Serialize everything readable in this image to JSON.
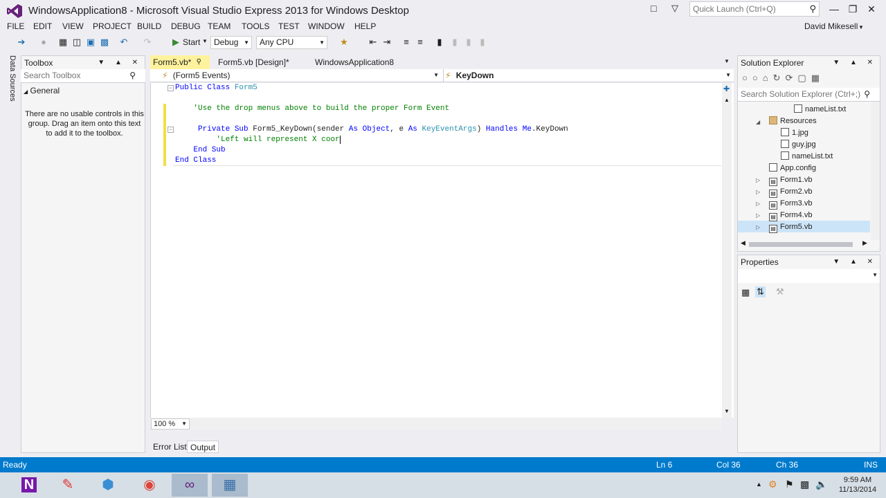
{
  "window": {
    "title": "WindowsApplication8 - Microsoft Visual Studio Express 2013 for Windows Desktop",
    "quick_launch_placeholder": "Quick Launch (Ctrl+Q)",
    "user": "David Mikesell"
  },
  "menu": [
    "FILE",
    "EDIT",
    "VIEW",
    "PROJECT",
    "BUILD",
    "DEBUG",
    "TEAM",
    "TOOLS",
    "TEST",
    "WINDOW",
    "HELP"
  ],
  "toolbar": {
    "start_label": "Start",
    "config": "Debug",
    "platform": "Any CPU"
  },
  "rail": {
    "label": "Data Sources"
  },
  "toolbox": {
    "title": "Toolbox",
    "search_placeholder": "Search Toolbox",
    "group": "General",
    "empty_message": "There are no usable controls in this group. Drag an item onto this text to add it to the toolbox."
  },
  "editor": {
    "tabs": [
      {
        "label": "Form5.vb*"
      },
      {
        "label": "Form5.vb [Design]*"
      },
      {
        "label": "WindowsApplication8"
      }
    ],
    "nav_left": "(Form5 Events)",
    "nav_right": "KeyDown",
    "code": {
      "line1_kw": "Public Class ",
      "line1_name": "Form5",
      "line2_comment": "'Use the drop menus above to build the proper Form Event",
      "line3_kw1": "Private Sub ",
      "line3_name": "Form5_KeyDown(sender ",
      "line3_kw2": "As Object",
      "line3_mid": ", e ",
      "line3_kw3": "As ",
      "line3_type": "KeyEventArgs",
      "line3_end1": ") ",
      "line3_kw4": "Handles ",
      "line3_kw5": "Me",
      "line3_end2": ".KeyDown",
      "line4_comment": "'Left will represent X coor",
      "line5_kw": "End Sub",
      "line6_kw": "End Class"
    },
    "zoom": "100 %"
  },
  "output_tabs": {
    "error_list": "Error List",
    "output": "Output"
  },
  "solution_explorer": {
    "title": "Solution Explorer",
    "search_placeholder": "Search Solution Explorer (Ctrl+;)",
    "items": [
      {
        "label": "nameList.txt"
      },
      {
        "label": "Resources"
      },
      {
        "label": "1.jpg"
      },
      {
        "label": "guy.jpg"
      },
      {
        "label": "nameList.txt"
      },
      {
        "label": "App.config"
      },
      {
        "label": "Form1.vb"
      },
      {
        "label": "Form2.vb"
      },
      {
        "label": "Form3.vb"
      },
      {
        "label": "Form4.vb"
      },
      {
        "label": "Form5.vb"
      }
    ]
  },
  "properties": {
    "title": "Properties"
  },
  "status": {
    "ready": "Ready",
    "line": "Ln 6",
    "col": "Col 36",
    "ch": "Ch 36",
    "mode": "INS"
  },
  "taskbar": {
    "time": "9:59 AM",
    "date": "11/13/2014"
  },
  "colors": {
    "accent": "#007acc",
    "tab_active": "#fff29d",
    "keyword": "#0000ff",
    "comment": "#008000",
    "type": "#2b91af"
  }
}
